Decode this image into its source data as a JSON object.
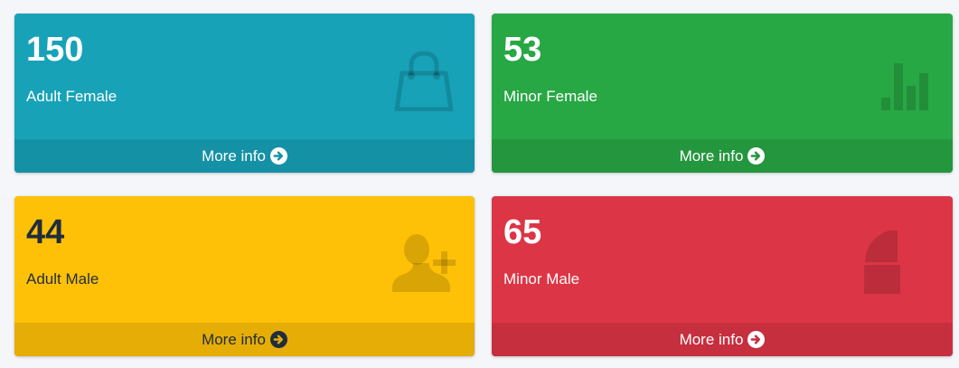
{
  "cards": [
    {
      "count": "150",
      "label": "Adult Female",
      "link": "More info",
      "icon": "shopping-bag-icon",
      "color": "#17a2b8"
    },
    {
      "count": "53",
      "label": "Minor Female",
      "link": "More info",
      "icon": "bar-chart-icon",
      "color": "#28a745"
    },
    {
      "count": "44",
      "label": "Adult Male",
      "link": "More info",
      "icon": "user-plus-icon",
      "color": "#ffc107"
    },
    {
      "count": "65",
      "label": "Minor Male",
      "link": "More info",
      "icon": "pie-chart-icon",
      "color": "#dc3545"
    }
  ]
}
